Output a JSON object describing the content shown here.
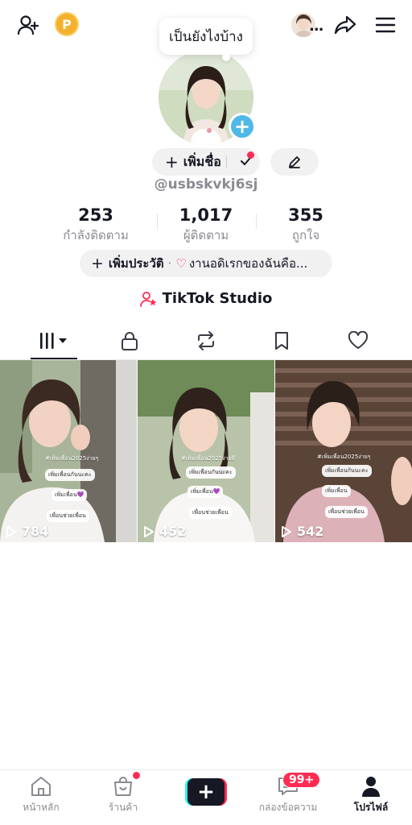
{
  "top_bar": {
    "coin_label": "P",
    "more_label": "..."
  },
  "profile": {
    "bubble_text": "เป็นยังไงบ้าง",
    "add_name_label": "เพิ่มชื่อ",
    "handle": "@usbskvkj6sj",
    "stats": [
      {
        "value": "253",
        "label": "กำลังติดตาม"
      },
      {
        "value": "1,017",
        "label": "ผู้ติดตาม"
      },
      {
        "value": "355",
        "label": "ถูกใจ"
      }
    ],
    "add_bio_label": "เพิ่มประวัติ",
    "bio_separator": "·",
    "bio_text": "งานอดิเรกของฉันคือ...",
    "studio_label": "TikTok Studio"
  },
  "tabs": [
    "videos-tab",
    "private-tab",
    "reposts-tab",
    "favorites-tab",
    "liked-tab"
  ],
  "videos": [
    {
      "views": "784",
      "overlay_title": "#เพิ่มเพื่อน2025ง่ายๆ",
      "stickers": [
        "เพิ่มเพื่อนกันนะคะ",
        "เพิ่มเพื่อน💜",
        "เพื่อนช่วยเพื่อน"
      ]
    },
    {
      "views": "452",
      "overlay_title": "#เพิ่มเพื่อน2025ง่ายดี",
      "stickers": [
        "เพิ่มเพื่อนกันนะคะ",
        "เพิ่มเพื่อน💜",
        "เพื่อนช่วยเพื่อน"
      ]
    },
    {
      "views": "542",
      "overlay_title": "#เพิ่มเพื่อน2025ง่ายๆ",
      "stickers": [
        "เพิ่มเพื่อนกันนะคะ",
        "เพิ่มเพื่อน",
        "เพื่อนช่วยเพื่อน"
      ]
    }
  ],
  "bottom_nav": {
    "home": "หน้าหลัก",
    "shop": "ร้านค้า",
    "create": "+",
    "inbox": "กล่องข้อความ",
    "inbox_badge": "99+",
    "profile": "โปรไฟล์"
  },
  "colors": {
    "accent_red": "#fe2c55",
    "accent_cyan": "#25f4ee",
    "avatar_plus_blue": "#4fb8e8",
    "coin_gold": "#f5b02c",
    "muted_text": "#8a8b91"
  }
}
